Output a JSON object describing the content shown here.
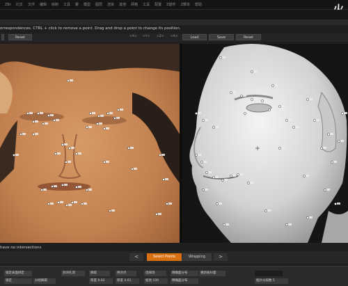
{
  "menu": {
    "items": [
      "ZBr",
      "幻文",
      "文件",
      "编辑",
      "绘制",
      "工具",
      "聚",
      "模型",
      "图层",
      "渲染",
      "其他",
      "网格",
      "工具",
      "配置",
      "Z插件",
      "Z脚本",
      "帮助"
    ],
    "logo": "火"
  },
  "info_line": "orrespondences. CTRL + click to remove a point. Drag and drop a point to change its position.",
  "toolbar": {
    "reset1": "Reset",
    "opts": [
      ">X<",
      ">Y<",
      ">Z<",
      ">X<"
    ],
    "load": "Load",
    "save": "Save",
    "reset2": "Reset"
  },
  "status_line": "have no intersections",
  "actions": {
    "left_arrow": "<",
    "select_points": "Select Points",
    "wrapping": "Wrapping",
    "right_arrow": ">"
  },
  "bottom": {
    "row1": {
      "a": "锁定表面绑定",
      "b": "封闭孔洞",
      "c": "摘取",
      "d": "绝对点",
      "e": "选择场",
      "f": "精确面分布",
      "g": "重新拓扑面"
    },
    "row2": {
      "a": "锁定",
      "b": "分组摘取",
      "c": "厚度 9.02",
      "d": "厚度 4.01",
      "e": "松弛 100",
      "f": "精确面分布",
      "g": "拓扑分段数 5"
    }
  },
  "colors": {
    "accent_orange": "#d9700f",
    "marker_fill": "#ffffff"
  }
}
